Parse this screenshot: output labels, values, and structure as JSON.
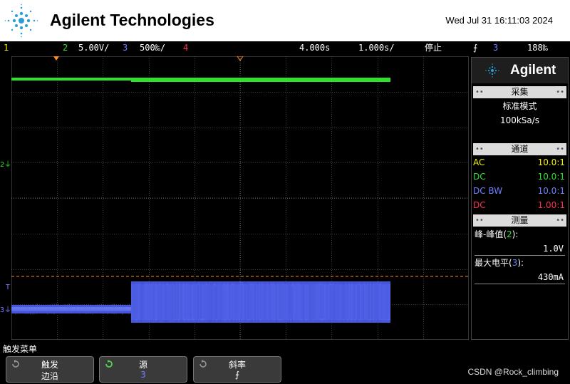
{
  "header": {
    "brand": "Agilent Technologies",
    "datetime": "Wed Jul 31 16:11:03 2024"
  },
  "status": {
    "ch1_num": "1",
    "ch2_num": "2",
    "ch2_scale": "5.00V/",
    "ch3_num": "3",
    "ch3_scale": "500‰/",
    "ch4_num": "4",
    "time_delay": "4.000s",
    "time_scale": "1.000s/",
    "run_state": "停止",
    "trigger_slope": "⨍",
    "trigger_source": "3",
    "trigger_level": "188‰"
  },
  "colors": {
    "ch1": "#f5f000",
    "ch2": "#2fe02f",
    "ch3": "#5563e8",
    "ch4": "#ff3050",
    "trigger": "#ff8c1a"
  },
  "markers": {
    "ch2_ground": "2",
    "ch3_ground": "3",
    "trigger_level_marker": "T"
  },
  "panel": {
    "logo": "Agilent",
    "acq_header": "采集",
    "acq_mode": "标准模式",
    "acq_rate": "100kSa/s",
    "chan_header": "通道",
    "channels": [
      {
        "coupling": "AC",
        "probe": "10.0:1"
      },
      {
        "coupling": "DC",
        "probe": "10.0:1"
      },
      {
        "coupling": "DC BW",
        "probe": "10.0:1"
      },
      {
        "coupling": "DC",
        "probe": "1.00:1"
      }
    ],
    "meas_header": "测量",
    "meas1_label": "峰-峰值",
    "meas1_ch": "2",
    "meas1_value": "1.0V",
    "meas2_label": "最大电平",
    "meas2_ch": "3",
    "meas2_value": "430mA"
  },
  "menu": {
    "title": "触发菜单",
    "softkeys": [
      {
        "title": "触发",
        "value": "边沿"
      },
      {
        "title": "源",
        "value": "3"
      },
      {
        "title": "斜率",
        "value": "⨍"
      }
    ]
  },
  "watermark": "CSDN @Rock_climbing"
}
